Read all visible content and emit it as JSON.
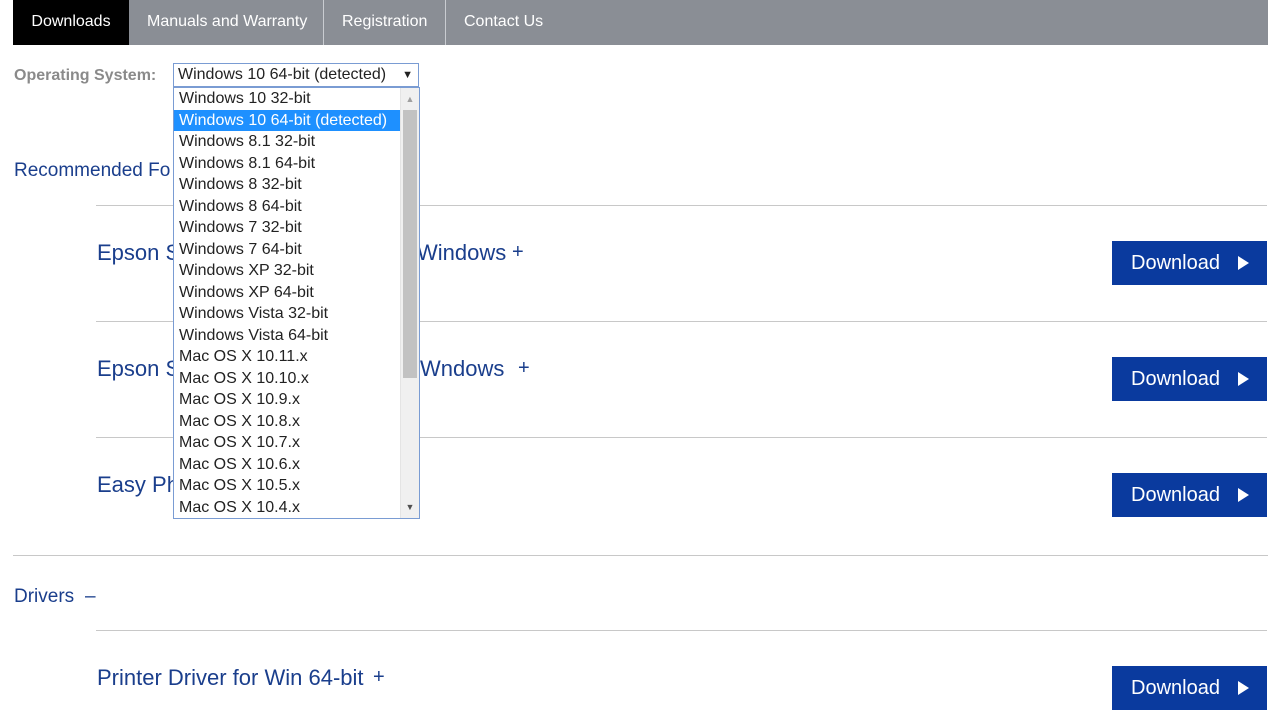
{
  "tabs": [
    {
      "label": "Downloads",
      "active": true
    },
    {
      "label": "Manuals and Warranty",
      "active": false
    },
    {
      "label": "Registration",
      "active": false
    },
    {
      "label": "Contact Us",
      "active": false
    }
  ],
  "os": {
    "label": "Operating System:",
    "selected": "Windows 10 64-bit (detected)",
    "options": [
      "Windows 10 32-bit",
      "Windows 10 64-bit (detected)",
      "Windows 8.1 32-bit",
      "Windows 8.1 64-bit",
      "Windows 8 32-bit",
      "Windows 8 64-bit",
      "Windows 7 32-bit",
      "Windows 7 64-bit",
      "Windows XP 32-bit",
      "Windows XP 64-bit",
      "Windows Vista 32-bit",
      "Windows Vista 64-bit",
      "Mac OS X 10.11.x",
      "Mac OS X 10.10.x",
      "Mac OS X 10.9.x",
      "Mac OS X 10.8.x",
      "Mac OS X 10.7.x",
      "Mac OS X 10.6.x",
      "Mac OS X 10.5.x",
      "Mac OS X 10.4.x"
    ],
    "selected_index": 1
  },
  "recommended": {
    "heading": "Recommended Fo",
    "items": [
      {
        "title_start": "Epson S",
        "title_end": "Windows",
        "toggle": "+",
        "download_label": "Download"
      },
      {
        "title_start": "Epson S",
        "title_end": "Wndows",
        "toggle": "+",
        "download_label": "Download"
      },
      {
        "title_start": "Easy Ph",
        "title_end": "",
        "toggle": "",
        "download_label": "Download"
      }
    ]
  },
  "drivers": {
    "heading": "Drivers",
    "toggle": "–",
    "items": [
      {
        "title": "Printer Driver for Win 64-bit",
        "toggle": "+",
        "download_label": "Download"
      }
    ]
  },
  "colors": {
    "tab_bar": "#8a8e95",
    "tab_active": "#000000",
    "link_blue": "#1a3e8c",
    "button_blue": "#0a3a9e",
    "option_highlight": "#1e90ff"
  }
}
